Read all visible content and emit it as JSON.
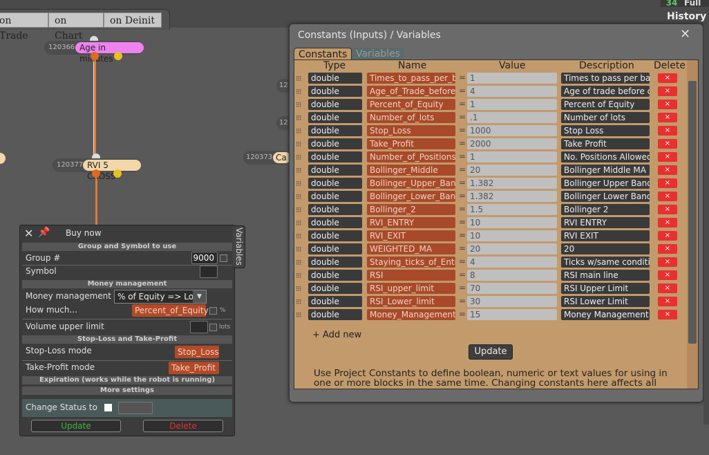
{
  "top": {
    "tabs": [
      "on Trade",
      "on Chart",
      "on Deinit"
    ],
    "counter": "34",
    "full_label": "Full",
    "history_label": "History"
  },
  "graph": {
    "nodes": [
      {
        "id": "120366",
        "label": "Age in minutes"
      },
      {
        "id": "120377",
        "label": "RVI 5 CROSS"
      }
    ],
    "stubs": {
      "a": "12",
      "b": "12",
      "c": "120373",
      "c_label": "Ca"
    }
  },
  "buy_panel": {
    "title": "Buy now",
    "section_group": "Group and Symbol to use",
    "group_label": "Group #",
    "group_value": "9000",
    "symbol_label": "Symbol",
    "section_money": "Money management",
    "mm_label": "Money management",
    "mm_value": "% of Equity => Lots",
    "how_label": "How much...",
    "how_value": "Percent_of_Equity",
    "pct_unit": "%",
    "volume_label": "Volume upper limit",
    "lots_unit": "lots",
    "section_sltp": "Stop-Loss and Take-Profit",
    "sl_label": "Stop-Loss mode",
    "sl_value": "Stop_Loss",
    "tp_label": "Take-Profit mode",
    "tp_value": "Take_Profit",
    "section_exp": "Expiration (works while the robot is running)",
    "section_more": "More settings",
    "status_label": "Change Status to",
    "update_label": "Update",
    "delete_label": "Delete",
    "variables_tab": "Variables"
  },
  "modal": {
    "title": "Constants (Inputs) / Variables",
    "tab_constants": "Constants",
    "tab_variables": "Variables",
    "headers": {
      "type": "Type",
      "name": "Name",
      "value": "Value",
      "description": "Description",
      "delete": "Delete"
    },
    "rows": [
      {
        "type": "double",
        "name": "Times_to_pass_per_bar",
        "value": "1",
        "desc": "Times to pass per bar"
      },
      {
        "type": "double",
        "name": "Age_of_Trade_before_close",
        "value": "4",
        "desc": "Age of trade before close"
      },
      {
        "type": "double",
        "name": "Percent_of_Equity",
        "value": "1",
        "desc": "Percent of Equity"
      },
      {
        "type": "double",
        "name": "Number_of_lots",
        "value": ".1",
        "desc": "Number of lots"
      },
      {
        "type": "double",
        "name": "Stop_Loss",
        "value": "1000",
        "desc": "Stop Loss"
      },
      {
        "type": "double",
        "name": "Take_Profit",
        "value": "2000",
        "desc": "Take Profit"
      },
      {
        "type": "double",
        "name": "Number_of_Positions",
        "value": "1",
        "desc": "No. Positions Allowed"
      },
      {
        "type": "double",
        "name": "Bollinger_Middle",
        "value": "20",
        "desc": "Bollinger Middle MA"
      },
      {
        "type": "double",
        "name": "Bollinger_Upper_Band",
        "value": "1.382",
        "desc": "Bollinger Upper Band"
      },
      {
        "type": "double",
        "name": "Bollinger_Lower_Band",
        "value": "1.382",
        "desc": "Bollinger Lower Band"
      },
      {
        "type": "double",
        "name": "Bollinger_2",
        "value": "1.5",
        "desc": "Bollinger 2"
      },
      {
        "type": "double",
        "name": "RVI_ENTRY",
        "value": "10",
        "desc": "RVI ENTRY"
      },
      {
        "type": "double",
        "name": "RVI_EXIT",
        "value": "10",
        "desc": "RVI EXIT"
      },
      {
        "type": "double",
        "name": "WEIGHTED_MA",
        "value": "20",
        "desc": "20"
      },
      {
        "type": "double",
        "name": "Staying_ticks_of_Entry",
        "value": "4",
        "desc": "Ticks w/same condition"
      },
      {
        "type": "double",
        "name": "RSI",
        "value": "8",
        "desc": "RSI main line"
      },
      {
        "type": "double",
        "name": "RSI_upper_limit",
        "value": "70",
        "desc": "RSI Upper Limit"
      },
      {
        "type": "double",
        "name": "RSI_Lower_limit",
        "value": "30",
        "desc": "RSI Lower Limit"
      },
      {
        "type": "double",
        "name": "Money_Management",
        "value": "15",
        "desc": "Money Management"
      }
    ],
    "eq_sign": "=",
    "delete_glyph": "×",
    "add_new": "+ Add new",
    "update": "Update",
    "hint": "Use Project Constants to define boolean, numeric or text values for using in one or more blocks in the same time. Changing constants here affects all the blocks that they are used in, at the same time."
  }
}
